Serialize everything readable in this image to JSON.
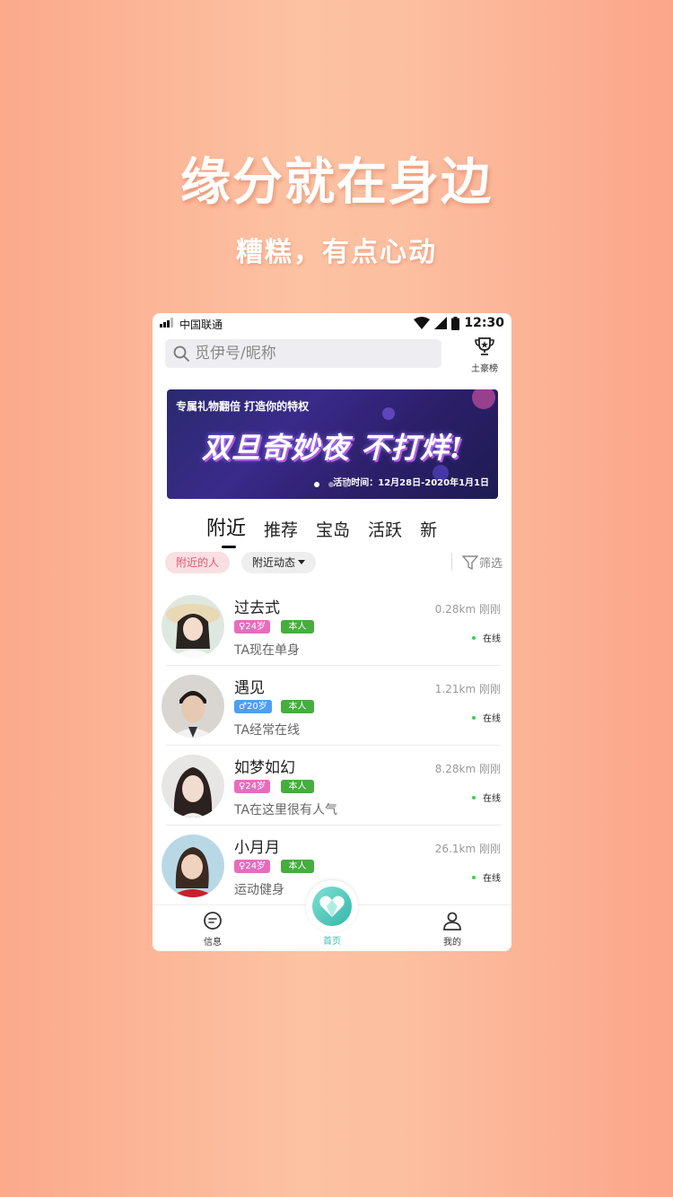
{
  "promo": {
    "headline": "缘分就在身边",
    "subline": "糟糕，有点心动"
  },
  "status_bar": {
    "carrier": "中国联通",
    "time": "12:30"
  },
  "search": {
    "placeholder": "觅伊号/昵称"
  },
  "rank": {
    "icon": "trophy-icon",
    "label": "土豪榜"
  },
  "banner": {
    "top_text": "专属礼物翻倍  打造你的特权",
    "title": "双旦奇妙夜 不打烊!",
    "date_text": "活动时间：12月28日-2020年1月1日",
    "slide_count": 3,
    "active_slide": 1
  },
  "tabs": [
    {
      "label": "附近",
      "active": true
    },
    {
      "label": "推荐",
      "active": false
    },
    {
      "label": "宝岛",
      "active": false
    },
    {
      "label": "活跃",
      "active": false
    },
    {
      "label": "新",
      "active": false
    }
  ],
  "filters": {
    "nearby_people": "附近的人",
    "nearby_moments": "附近动态",
    "filter": "筛选"
  },
  "users": [
    {
      "name": "过去式",
      "gender": "female",
      "age": "24岁",
      "verified": "本人",
      "bio": "TA现在单身",
      "distance": "0.28km",
      "time": "刚刚",
      "status": "在线"
    },
    {
      "name": "遇见",
      "gender": "male",
      "age": "20岁",
      "verified": "本人",
      "bio": "TA经常在线",
      "distance": "1.21km",
      "time": "刚刚",
      "status": "在线"
    },
    {
      "name": "如梦如幻",
      "gender": "female",
      "age": "24岁",
      "verified": "本人",
      "bio": "TA在这里很有人气",
      "distance": "8.28km",
      "time": "刚刚",
      "status": "在线"
    },
    {
      "name": "小月月",
      "gender": "female",
      "age": "24岁",
      "verified": "本人",
      "bio": "运动健身",
      "distance": "26.1km",
      "time": "刚刚",
      "status": "在线"
    }
  ],
  "nav": {
    "messages": "信息",
    "home": "首页",
    "mine": "我的"
  },
  "colors": {
    "accent": "#3ebfb6",
    "female": "#e86cbd",
    "male": "#4e9ff0",
    "verified": "#46ad3f",
    "online": "#37d14a"
  }
}
